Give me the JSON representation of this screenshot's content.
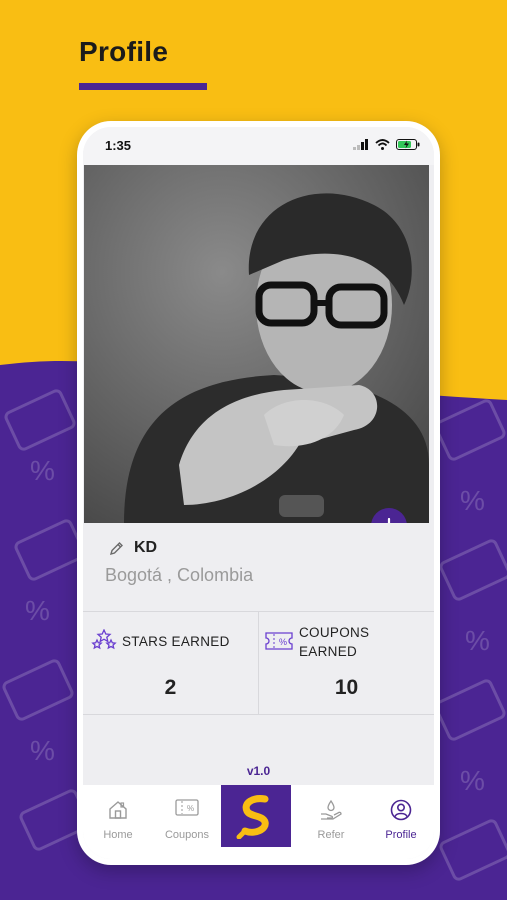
{
  "page": {
    "title": "Profile"
  },
  "status_bar": {
    "time": "1:35"
  },
  "profile": {
    "name": "KD",
    "location": "Bogotá , Colombia"
  },
  "stats": [
    {
      "label_line1": "STARS EARNED",
      "label_line2": "",
      "value": "2",
      "icon": "stars-icon"
    },
    {
      "label_line1": "COUPONS",
      "label_line2": "EARNED",
      "value": "10",
      "icon": "coupon-icon"
    }
  ],
  "version": "v1.0",
  "nav": {
    "items": [
      {
        "label": "Home",
        "icon": "home-icon"
      },
      {
        "label": "Coupons",
        "icon": "coupon-icon"
      },
      {
        "label": "",
        "icon": "app-logo-icon"
      },
      {
        "label": "Refer",
        "icon": "refer-icon"
      },
      {
        "label": "Profile",
        "icon": "profile-icon"
      }
    ],
    "active": "Profile"
  },
  "colors": {
    "yellow": "#F9BE13",
    "purple": "#4B2593",
    "muted": "#9a9a9a"
  }
}
